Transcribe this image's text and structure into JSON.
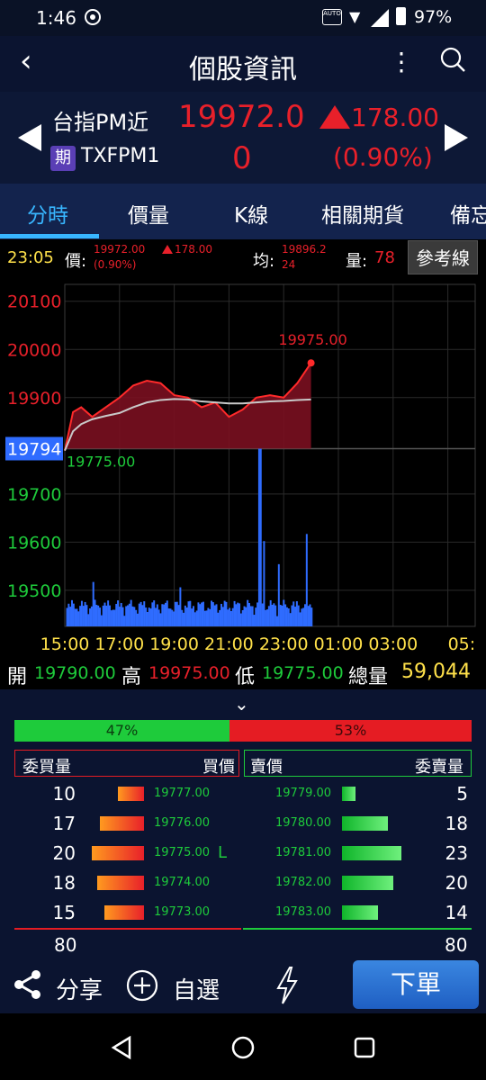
{
  "status_bar": {
    "time": "1:46",
    "auto_label": "AUTO",
    "battery": "97%"
  },
  "header": {
    "title": "個股資訊",
    "back_icon": "chevron-left-icon",
    "more_icon": "more-vert-icon",
    "search_icon": "search-icon"
  },
  "quote": {
    "name": "台指PM近",
    "badge": "期",
    "code": "TXFPM1",
    "price_line1": "19972.0",
    "price_line2": "0",
    "change": "178.00",
    "change_pct": "(0.90%)",
    "up_color": "#e8202a"
  },
  "tabs": [
    {
      "label": "分時",
      "active": true
    },
    {
      "label": "價量"
    },
    {
      "label": "K線"
    },
    {
      "label": "相關期貨"
    },
    {
      "label": "備忘"
    }
  ],
  "info": {
    "time": "23:05",
    "price_label": "價:",
    "price": "19972.00",
    "pct": "(0.90%)",
    "change": "178.00",
    "avg_label": "均:",
    "avg_line1": "19896.2",
    "avg_line2": "24",
    "vol_label": "量:",
    "vol": "78",
    "ref_button": "參考線"
  },
  "chart_data": {
    "type": "area",
    "reference": "19794",
    "high_label": "19975.00",
    "low_label": "19775.00",
    "y_labels": [
      "20100",
      "20000",
      "19900",
      "19794",
      "19700",
      "19600",
      "19500"
    ],
    "x_labels": [
      "15:00",
      "17:00",
      "19:00",
      "21:00",
      "23:00",
      "01:00",
      "03:00",
      "05:"
    ],
    "ylim": [
      19425,
      20135
    ],
    "x_hours": [
      0,
      0.3,
      0.6,
      1,
      1.5,
      2,
      2.5,
      3,
      3.5,
      4,
      4.5,
      5,
      5.5,
      6,
      6.5,
      7,
      7.5,
      8,
      8.5,
      9
    ],
    "price": [
      19790,
      19870,
      19880,
      19860,
      19880,
      19900,
      19925,
      19935,
      19930,
      19905,
      19900,
      19880,
      19890,
      19860,
      19875,
      19900,
      19905,
      19900,
      19930,
      19972
    ],
    "avg": [
      19790,
      19830,
      19845,
      19855,
      19862,
      19868,
      19880,
      19890,
      19895,
      19897,
      19896,
      19892,
      19890,
      19888,
      19888,
      19890,
      19892,
      19893,
      19895,
      19896
    ],
    "volume_peaks": [
      {
        "x_hours": 7.1,
        "ratio": 1.0
      },
      {
        "x_hours": 7.25,
        "ratio": 0.48
      },
      {
        "x_hours": 8.8,
        "ratio": 0.52
      },
      {
        "x_hours": 7.8,
        "ratio": 0.35
      },
      {
        "x_hours": 1.0,
        "ratio": 0.25
      },
      {
        "x_hours": 4.2,
        "ratio": 0.22
      }
    ],
    "colors": {
      "up_area": "#7a1020",
      "up_line": "#ff2a2a",
      "avg_line": "#c9c9c9",
      "volume": "#2f6cff",
      "ref_line": "#555555"
    }
  },
  "ohlc": {
    "open_label": "開",
    "open": "19790.00",
    "high_label": "高",
    "high": "19975.00",
    "low_label": "低",
    "low": "19775.00",
    "total_label": "總量",
    "total": "59,044"
  },
  "book": {
    "buy_pct": "47%",
    "sell_pct": "53%",
    "buy_qty_header": "委買量",
    "buy_price_header": "買價",
    "sell_price_header": "賣價",
    "sell_qty_header": "委賣量",
    "rows": [
      {
        "bq": "10",
        "bp": "19777.00",
        "sp": "19779.00",
        "sq": "5",
        "bw": 0.5,
        "sw": 0.22
      },
      {
        "bq": "17",
        "bp": "19776.00",
        "sp": "19780.00",
        "sq": "18",
        "bw": 0.85,
        "sw": 0.78
      },
      {
        "bq": "20",
        "bp": "19775.00",
        "sp": "19781.00",
        "sq": "23",
        "bw": 1.0,
        "sw": 1.0,
        "mark": "L"
      },
      {
        "bq": "18",
        "bp": "19774.00",
        "sp": "19782.00",
        "sq": "20",
        "bw": 0.9,
        "sw": 0.87
      },
      {
        "bq": "15",
        "bp": "19773.00",
        "sp": "19783.00",
        "sq": "14",
        "bw": 0.75,
        "sw": 0.61
      }
    ],
    "total_buy": "80",
    "total_sell": "80"
  },
  "actions": {
    "share": "分享",
    "watch": "自選",
    "order": "下單",
    "share_icon": "share-icon",
    "add_icon": "plus-circle-icon",
    "flash_icon": "lightning-icon"
  },
  "nav": {
    "back_icon": "nav-back-icon",
    "home_icon": "nav-home-icon",
    "recents_icon": "nav-recents-icon"
  }
}
